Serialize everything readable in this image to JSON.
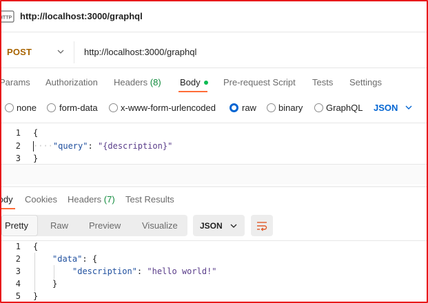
{
  "window": {
    "title": "http://localhost:3000/graphql",
    "badge_icon": "http-request-icon"
  },
  "request": {
    "method": "POST",
    "url": "http://localhost:3000/graphql",
    "tabs": [
      {
        "label": "Params"
      },
      {
        "label": "Authorization"
      },
      {
        "label": "Headers",
        "count": "(8)"
      },
      {
        "label": "Body",
        "active": true
      },
      {
        "label": "Pre-request Script"
      },
      {
        "label": "Tests"
      },
      {
        "label": "Settings"
      }
    ],
    "body_types": [
      {
        "label": "none",
        "checked": false
      },
      {
        "label": "form-data",
        "checked": false
      },
      {
        "label": "x-www-form-urlencoded",
        "checked": false
      },
      {
        "label": "raw",
        "checked": true
      },
      {
        "label": "binary",
        "checked": false
      },
      {
        "label": "GraphQL",
        "checked": false
      }
    ],
    "raw_format": "JSON",
    "body_lines": [
      {
        "num": "1",
        "text": "{"
      },
      {
        "num": "2",
        "key": "\"query\"",
        "sep": ": ",
        "value": "\"{description}\""
      },
      {
        "num": "3",
        "text": "}"
      }
    ]
  },
  "response": {
    "tabs": [
      {
        "label": "Body",
        "active": true
      },
      {
        "label": "Cookies"
      },
      {
        "label": "Headers",
        "count": "(7)"
      },
      {
        "label": "Test Results"
      }
    ],
    "views": [
      "Pretty",
      "Raw",
      "Preview",
      "Visualize"
    ],
    "active_view": "Pretty",
    "format": "JSON",
    "lines": [
      {
        "num": "1",
        "text": "{"
      },
      {
        "num": "2",
        "key": "\"data\"",
        "sep": ": ",
        "text": "{"
      },
      {
        "num": "3",
        "key": "\"description\"",
        "sep": ": ",
        "value": "\"hello world!\""
      },
      {
        "num": "4",
        "text": "}"
      },
      {
        "num": "5",
        "text": "}"
      }
    ]
  },
  "colors": {
    "accent": "#ff6c37",
    "method": "#a86400",
    "link_blue": "#0265d2",
    "count_green": "#0f8a3b",
    "frame_red": "#e8191b"
  }
}
